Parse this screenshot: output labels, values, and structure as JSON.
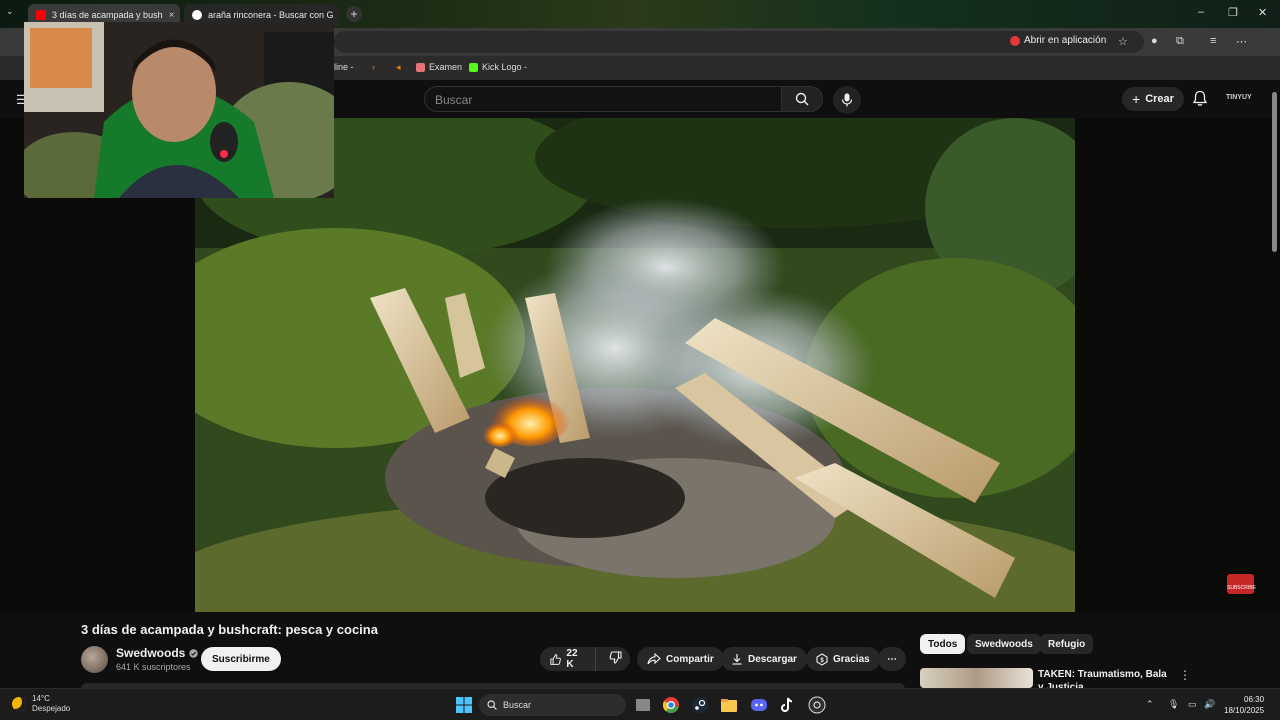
{
  "browser": {
    "tabs": [
      {
        "title": "3 días de acampada y bush",
        "active": true
      },
      {
        "title": "araña rinconera - Buscar con G",
        "active": false
      }
    ],
    "open_in_app": "Abrir en aplicación",
    "bookmarks": [
      {
        "label": "line -"
      },
      {
        "label": "Examen"
      },
      {
        "label": "Kick Logo -"
      }
    ]
  },
  "youtube": {
    "search_placeholder": "Buscar",
    "create_label": "Crear",
    "profile_label": "TINYUY",
    "subscribe_watermark": "SUBSCRIBE"
  },
  "video": {
    "title": "3 días de acampada y bushcraft: pesca y cocina",
    "channel": "Swedwoods",
    "subscribers": "641 K suscriptores",
    "subscribe_label": "Suscribirme",
    "likes": "22 K",
    "share_label": "Compartir",
    "download_label": "Descargar",
    "thanks_label": "Gracias"
  },
  "recommendations": {
    "chips": [
      {
        "label": "Todos",
        "selected": true
      },
      {
        "label": "Swedwoods",
        "selected": false
      },
      {
        "label": "Refugio",
        "selected": false
      }
    ],
    "first": {
      "title": "TAKEN: Traumatismo, Bala y Justicia"
    }
  },
  "taskbar": {
    "weather_temp": "14°C",
    "weather_desc": "Despejado",
    "search_label": "Buscar",
    "time": "06:30",
    "date": "18/10/2025"
  },
  "colors": {
    "accent": "#ff0000",
    "bg": "#0f0f0f",
    "chip_bg": "#272727"
  }
}
